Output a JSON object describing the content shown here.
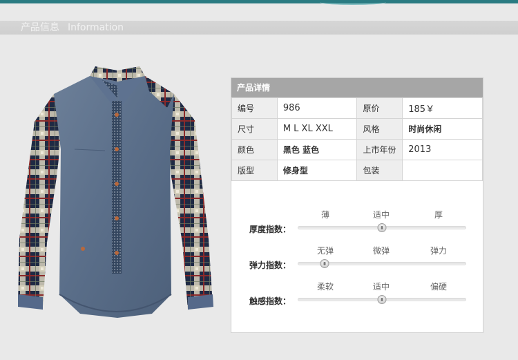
{
  "header": {
    "title_cn": "产品信息",
    "title_en": "Information"
  },
  "panel": {
    "title": "产品详情",
    "rows": [
      [
        {
          "label": "编号",
          "value": "986"
        },
        {
          "label": "原价",
          "value": "185￥"
        }
      ],
      [
        {
          "label": "尺寸",
          "value": "M L XL XXL"
        },
        {
          "label": "风格",
          "value": "时尚休闲"
        }
      ],
      [
        {
          "label": "颜色",
          "value": "黑色  蓝色"
        },
        {
          "label": "上市年份",
          "value": "2013"
        }
      ],
      [
        {
          "label": "版型",
          "value": "修身型"
        },
        {
          "label": "包装",
          "value": ""
        }
      ]
    ]
  },
  "meters": [
    {
      "label": "厚度指数：",
      "ticks": [
        "薄",
        "适中",
        "厚"
      ],
      "level": 0.5
    },
    {
      "label": "弹力指数：",
      "ticks": [
        "无弹",
        "微弹",
        "弹力"
      ],
      "level": 0.16
    },
    {
      "label": "触感指数：",
      "ticks": [
        "柔软",
        "适中",
        "偏硬"
      ],
      "level": 0.5
    }
  ],
  "colors": {
    "teal_accent": "#2a7b82",
    "header_bar": "#d2d2d2",
    "panel_header": "#a6a6a6",
    "shirt_denim": "#5b6f8a",
    "plaid_navy": "#1f2a44",
    "plaid_red": "#8b2a2a",
    "plaid_cream": "#d8d2bd",
    "button_copper": "#b8683c"
  }
}
